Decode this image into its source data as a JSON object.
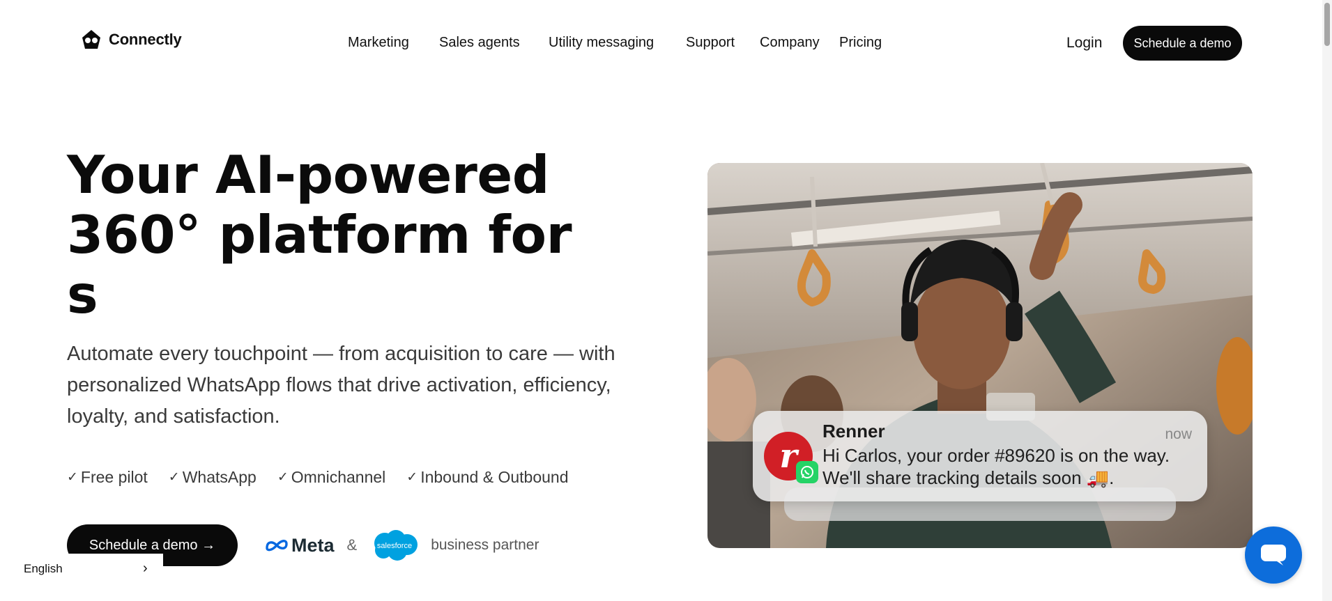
{
  "header": {
    "logo_text": "Connectly",
    "nav": [
      {
        "label": "Marketing"
      },
      {
        "label": "Sales agents"
      },
      {
        "label": "Utility messaging"
      },
      {
        "label": "Support"
      },
      {
        "label": "Company"
      },
      {
        "label": "Pricing"
      }
    ],
    "login_label": "Login",
    "cta_label": "Schedule a demo"
  },
  "hero": {
    "title_line1": "Your AI-powered",
    "title_line2": "360° platform for",
    "title_line3": "s",
    "subtitle": "Automate every touchpoint — from acquisition to care — with personalized WhatsApp flows that drive activation, efficiency, loyalty, and satisfaction.",
    "features": [
      "Free pilot",
      "WhatsApp",
      "Omnichannel",
      "Inbound & Outbound"
    ],
    "cta_label": "Schedule a demo →",
    "partners": {
      "meta_label": "Meta",
      "ampersand": "&",
      "salesforce_label": "salesforce",
      "suffix": "business partner"
    }
  },
  "notification": {
    "avatar_letter": "r",
    "sender": "Renner",
    "time": "now",
    "message": "Hi Carlos, your order #89620 is on the way. We'll share tracking details soon 🚚."
  },
  "language": {
    "label": "English",
    "chevron": "›"
  },
  "colors": {
    "brand_dark": "#0a0a0a",
    "chat_blue": "#0d6ddb",
    "renner_red": "#d11f26",
    "whatsapp_green": "#25d366",
    "meta_blue": "#0668e1",
    "salesforce_blue": "#00a1e0"
  },
  "icons": {
    "logo": "connectly-logo-icon",
    "check": "check-icon",
    "chat": "chat-bubble-icon",
    "whatsapp": "whatsapp-icon",
    "meta": "meta-infinity-icon",
    "salesforce": "salesforce-cloud-icon",
    "arrow": "arrow-right-icon",
    "chevron": "chevron-right-icon"
  }
}
